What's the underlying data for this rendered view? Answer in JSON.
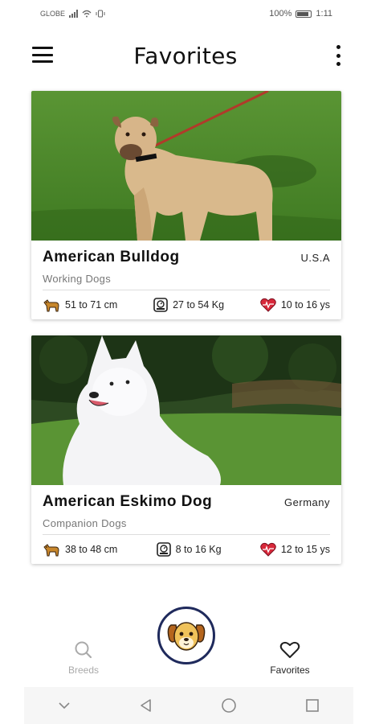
{
  "status_bar": {
    "carrier": "GLOBE",
    "battery": "100%",
    "time": "1:11"
  },
  "header": {
    "title": "Favorites"
  },
  "cards": [
    {
      "name": "American Bulldog",
      "origin": "U.S.A",
      "group": "Working Dogs",
      "height": "51 to 71 cm",
      "weight": "27 to 54 Kg",
      "lifespan": "10 to 16 ys"
    },
    {
      "name": "American Eskimo Dog",
      "origin": "Germany",
      "group": "Companion Dogs",
      "height": "38 to 48 cm",
      "weight": "8 to 16 Kg",
      "lifespan": "12 to 15 ys"
    }
  ],
  "bottom_nav": {
    "breeds_label": "Breeds",
    "favorites_label": "Favorites",
    "active": "Favorites"
  },
  "colors": {
    "fab_border": "#1f2a5c",
    "grass": "#4f8a2e",
    "heart": "#d8283a",
    "dog_icon": "#c8872c"
  },
  "icons": [
    "menu-icon",
    "more-vert-icon",
    "dog-height-icon",
    "scale-icon",
    "heart-icon",
    "search-icon",
    "dog-face-icon",
    "heart-outline-icon",
    "back-icon",
    "home-icon",
    "recents-icon",
    "chevron-down-icon"
  ]
}
